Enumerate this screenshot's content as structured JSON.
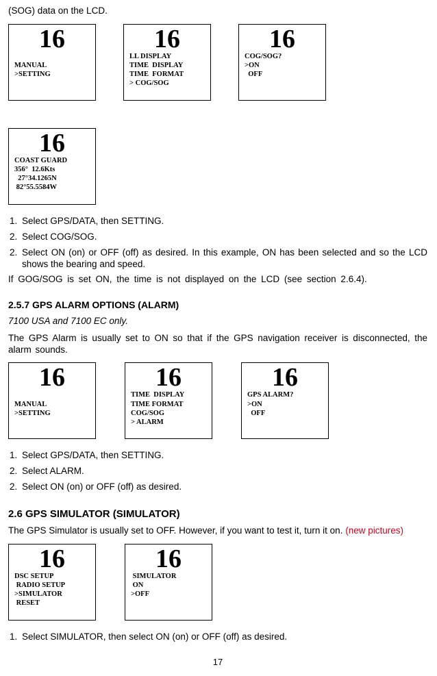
{
  "intro": "(SOG) data on the LCD.",
  "lcd_set1": {
    "screens": [
      {
        "channel": "16",
        "body": "\nMANUAL\n>SETTING"
      },
      {
        "channel": "16",
        "body": "LL DISPLAY\nTIME  DISPLAY\nTIME  FORMAT\n> COG/SOG"
      },
      {
        "channel": "16",
        "body": "COG/SOG?\n>ON\n  OFF"
      },
      {
        "channel": "16",
        "body": "COAST GUARD\n356°  12.6Kts\n  27°34.1265N\n 82°55.5584W"
      }
    ]
  },
  "steps1": [
    {
      "n": "1.",
      "t": "Select GPS/DATA, then SETTING."
    },
    {
      "n": "2.",
      "t": "Select COG/SOG."
    },
    {
      "n": "2.",
      "t": "Select ON (on) or OFF (off) as desired. In this example, ON has been selected and so the LCD shows the bearing and speed."
    }
  ],
  "note1": "If GOG/SOG is set ON, the time is not displayed on the LCD (see section 2.6.4).",
  "sec257": {
    "title": "2.5.7 GPS ALARM OPTIONS (ALARM)",
    "sub": "7100 USA and 7100 EC only.",
    "desc": "The GPS Alarm is usually set to ON so that if the GPS navigation receiver is disconnected, the alarm sounds."
  },
  "lcd_set2": {
    "screens": [
      {
        "channel": "16",
        "body": "\nMANUAL\n>SETTING"
      },
      {
        "channel": "16",
        "body": "TIME  DISPLAY\nTIME FORMAT\nCOG/SOG\n> ALARM"
      },
      {
        "channel": "16",
        "body": "GPS ALARM?\n>ON\n  OFF"
      }
    ]
  },
  "steps2": [
    {
      "n": "1.",
      "t": "Select GPS/DATA, then SETTING."
    },
    {
      "n": "2.",
      "t": "Select ALARM."
    },
    {
      "n": "2.",
      "t": "Select ON (on) or OFF (off) as desired."
    }
  ],
  "sec26": {
    "title": "2.6 GPS SIMULATOR (SIMULATOR)",
    "desc": "The GPS Simulator is usually set to OFF. However, if you want to test it, turn it on. ",
    "red": "(new pictures)"
  },
  "lcd_set3": {
    "screens": [
      {
        "channel": "16",
        "body": "DSC SETUP\n RADIO SETUP\n>SIMULATOR\n RESET"
      },
      {
        "channel": "16",
        "body": " SIMULATOR\n ON\n>OFF"
      }
    ]
  },
  "steps3": [
    {
      "n": "1.",
      "t": "Select SIMULATOR, then select ON (on) or OFF (off) as desired."
    }
  ],
  "page": "17"
}
